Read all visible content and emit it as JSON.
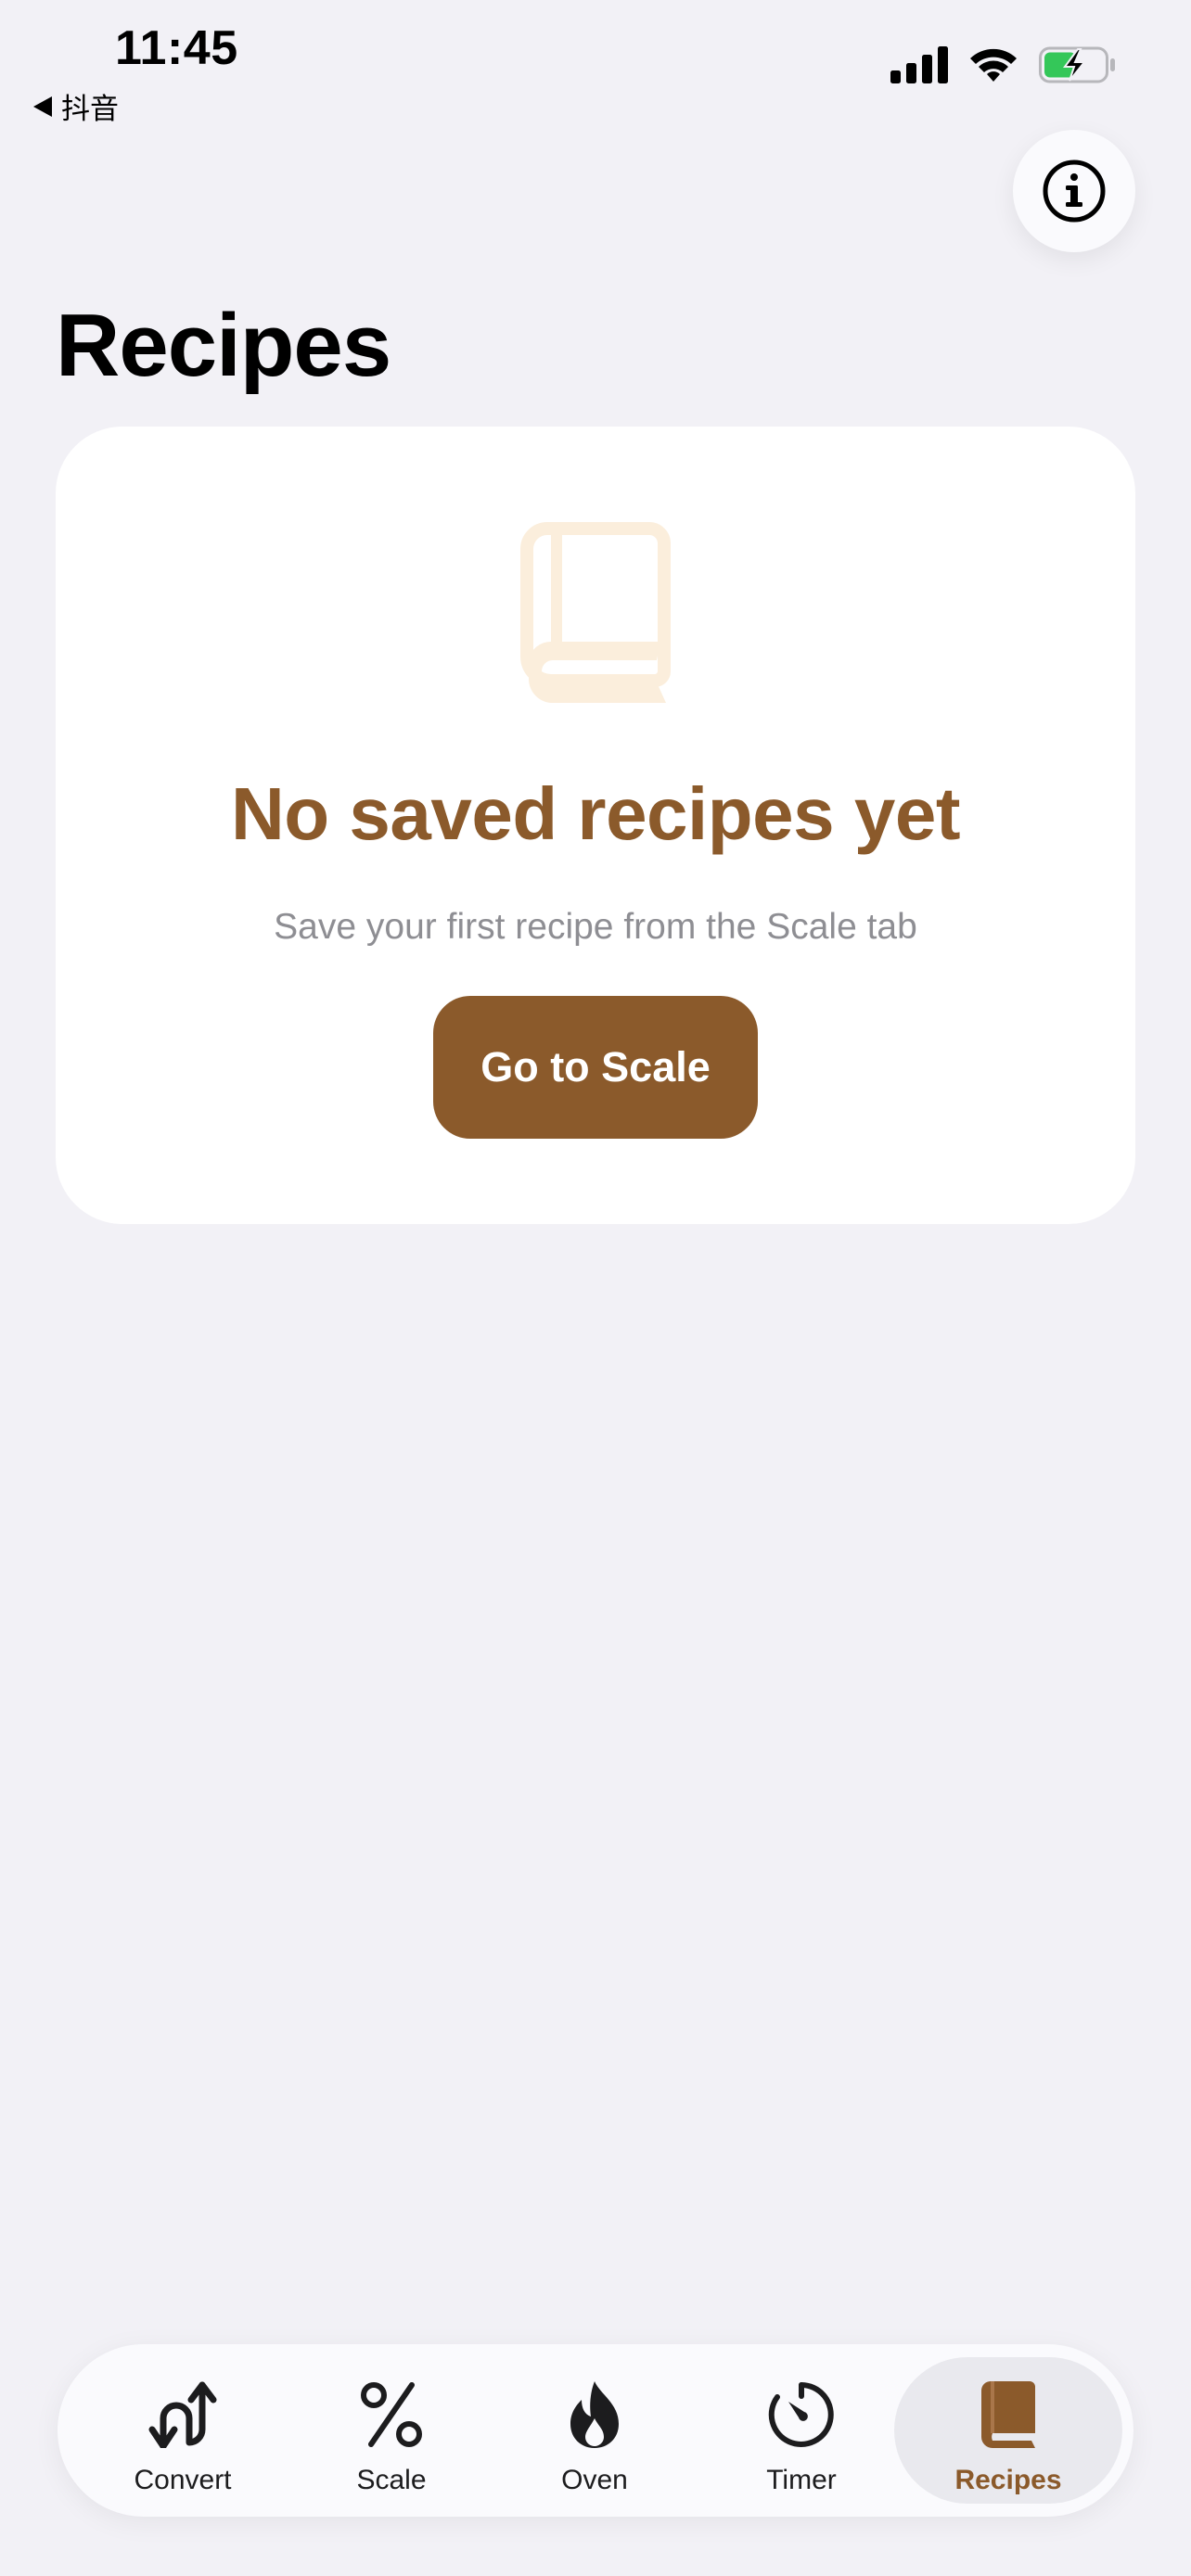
{
  "status_bar": {
    "time": "11:45",
    "back_app": "抖音"
  },
  "header": {
    "title": "Recipes",
    "info_icon": "info-circle-icon"
  },
  "empty_state": {
    "icon": "book-icon",
    "title": "No saved recipes yet",
    "subtitle": "Save your first recipe from the Scale tab",
    "button_label": "Go to Scale"
  },
  "tabs": [
    {
      "label": "Convert",
      "icon": "convert-arrows-icon",
      "selected": false
    },
    {
      "label": "Scale",
      "icon": "percent-icon",
      "selected": false
    },
    {
      "label": "Oven",
      "icon": "flame-icon",
      "selected": false
    },
    {
      "label": "Timer",
      "icon": "timer-icon",
      "selected": false
    },
    {
      "label": "Recipes",
      "icon": "book-icon",
      "selected": true
    }
  ],
  "colors": {
    "accent": "#8B5A2B",
    "background": "#F2F1F6",
    "card": "#FFFFFF",
    "book_illustration": "#FBEEDC",
    "subtitle": "#8E8E93",
    "battery_fill": "#34C759"
  }
}
